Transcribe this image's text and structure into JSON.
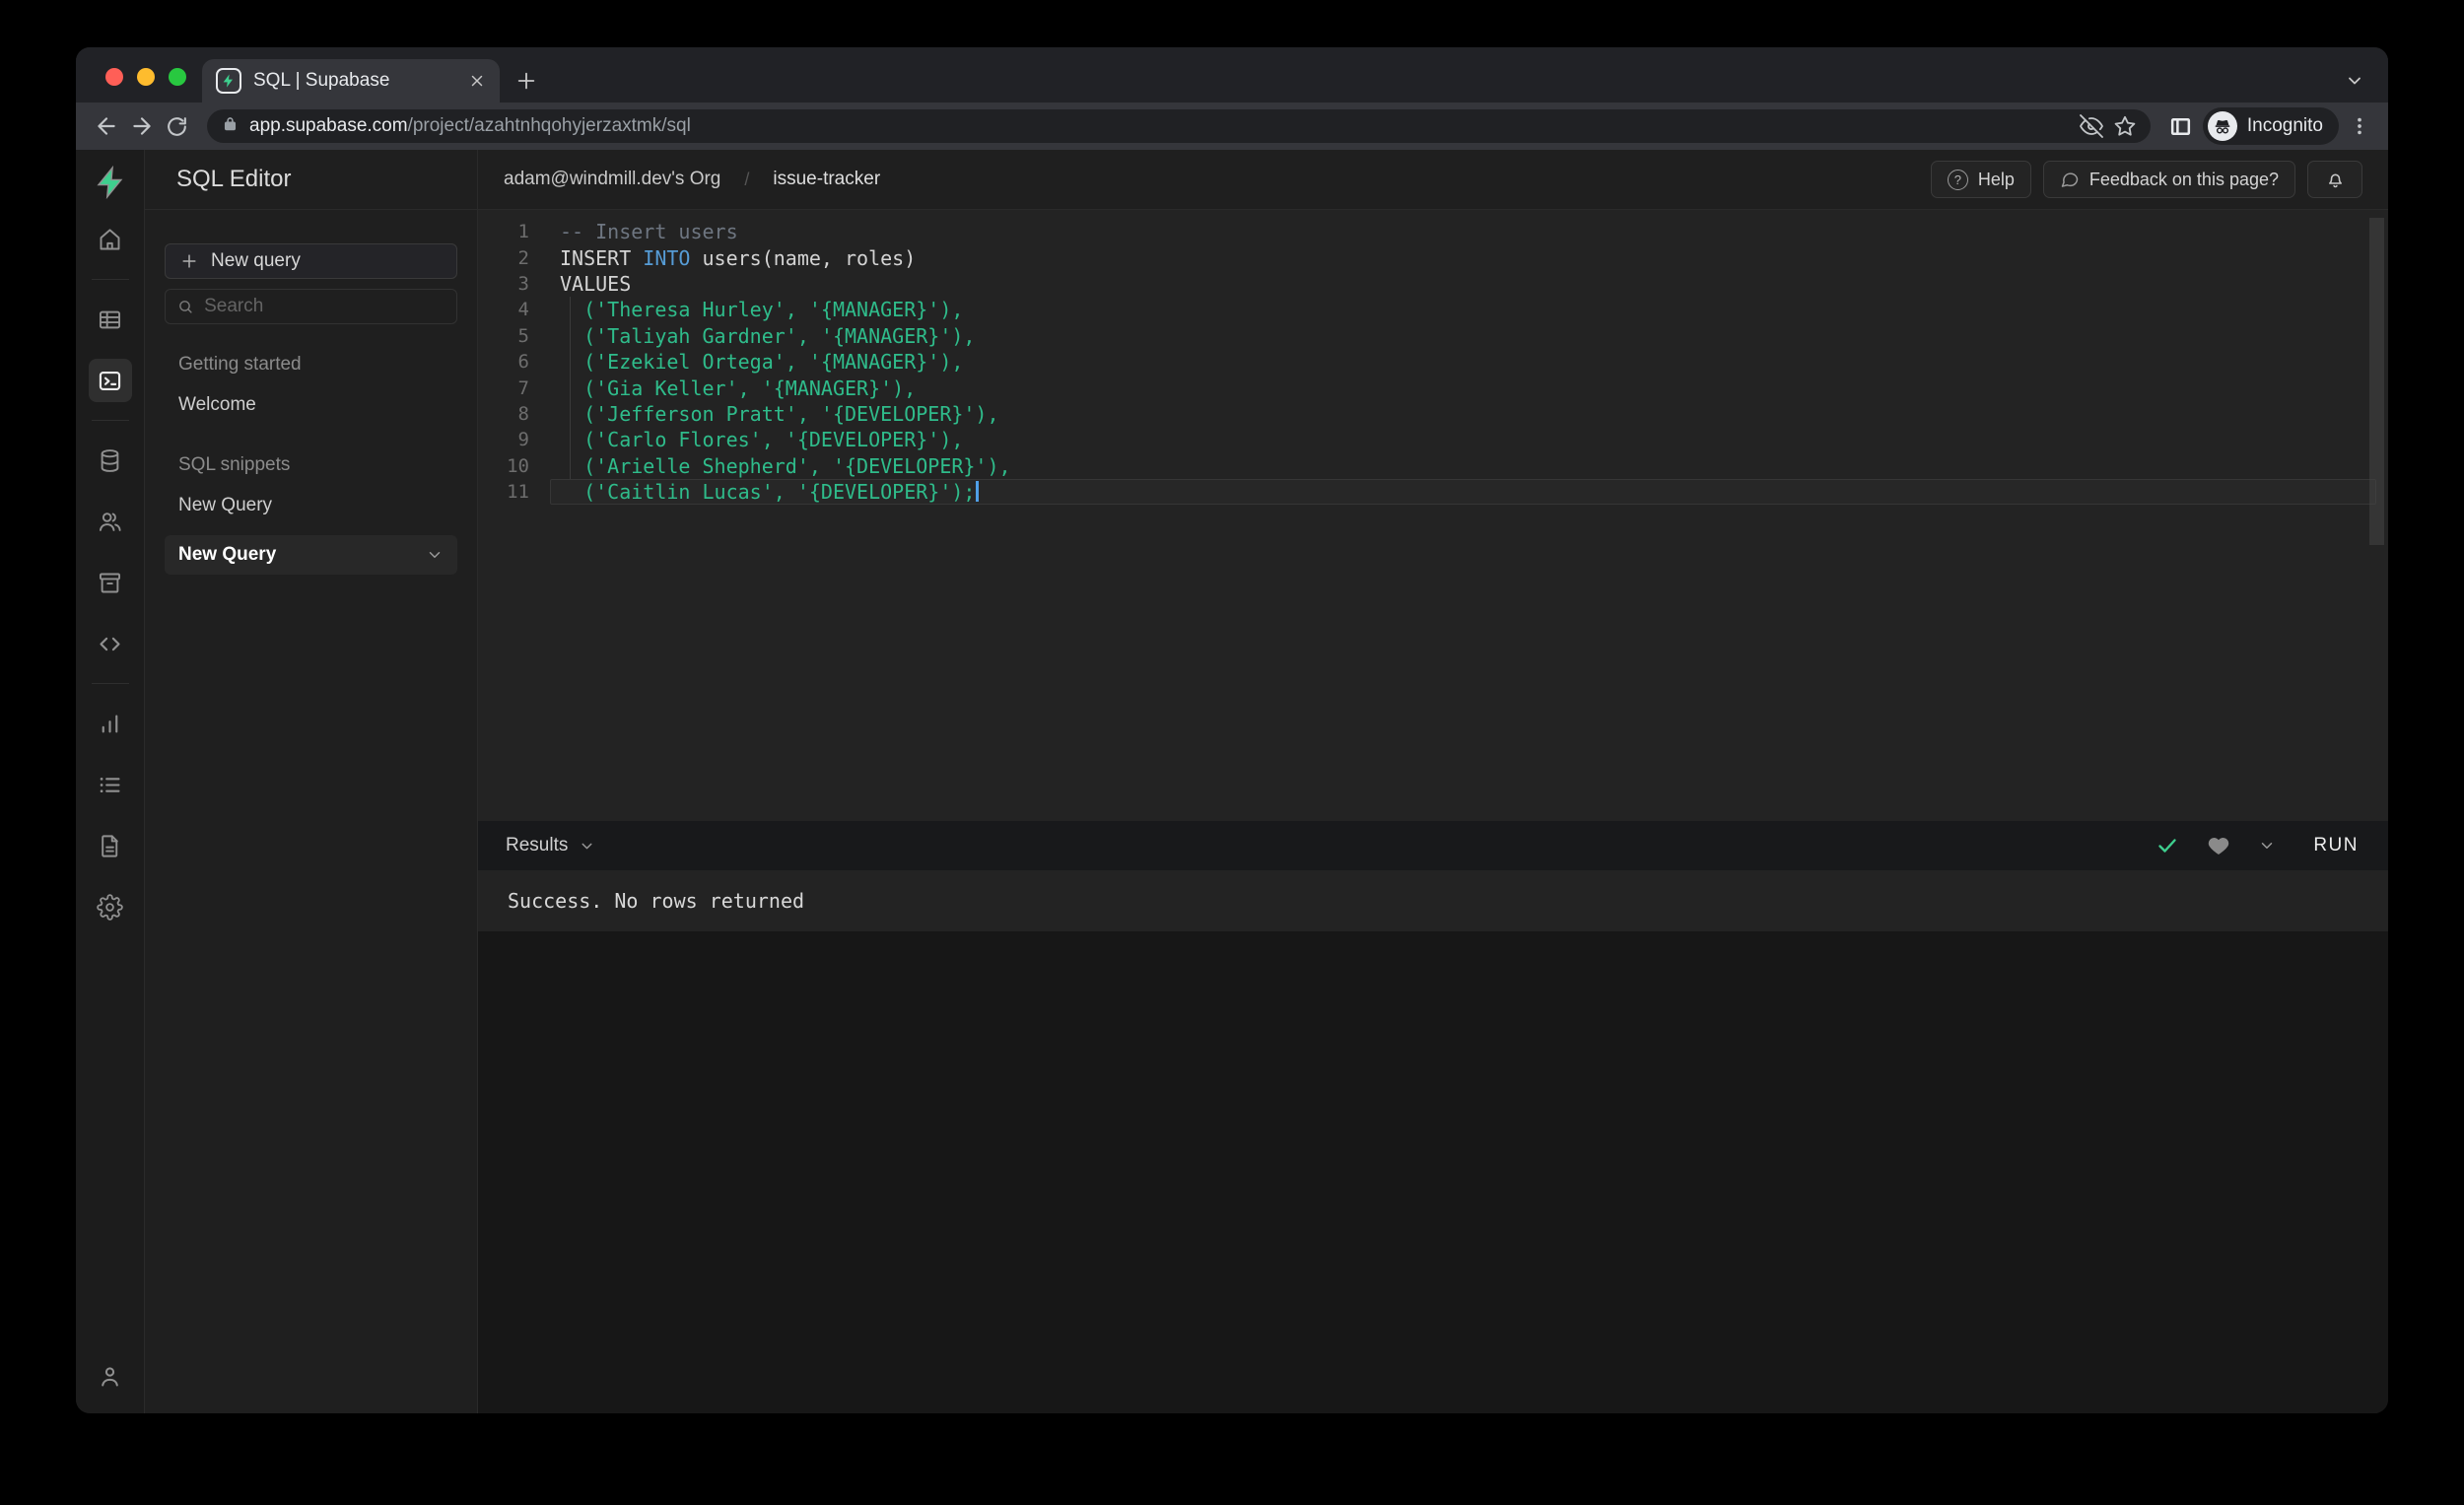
{
  "browser": {
    "tab_title": "SQL | Supabase",
    "url": {
      "domain": "app.supabase.com",
      "path": "/project/azahtnhqohyjerzaxtmk/sql"
    },
    "incognito_label": "Incognito"
  },
  "app": {
    "sidebar": {
      "title": "SQL Editor",
      "new_query_button": "New query",
      "search_placeholder": "Search",
      "sections": [
        {
          "label": "Getting started",
          "items": [
            {
              "label": "Welcome",
              "selected": false
            }
          ]
        },
        {
          "label": "SQL snippets",
          "items": [
            {
              "label": "New Query",
              "selected": false
            },
            {
              "label": "New Query",
              "selected": true
            }
          ]
        }
      ]
    },
    "header": {
      "breadcrumb": {
        "org": "adam@windmill.dev's Org",
        "separator": "/",
        "project": "issue-tracker"
      },
      "help_label": "Help",
      "help_icon_glyph": "?",
      "feedback_label": "Feedback on this page?"
    },
    "editor": {
      "lines": [
        {
          "n": 1,
          "segs": [
            [
              "comment",
              "-- Insert users"
            ]
          ]
        },
        {
          "n": 2,
          "segs": [
            [
              "plain",
              "INSERT "
            ],
            [
              "kw",
              "INTO"
            ],
            [
              "plain",
              " users(name, roles)"
            ]
          ]
        },
        {
          "n": 3,
          "segs": [
            [
              "plain",
              "VALUES"
            ]
          ]
        },
        {
          "n": 4,
          "segs": [
            [
              "str",
              "  ('Theresa Hurley', '{MANAGER}'),"
            ]
          ]
        },
        {
          "n": 5,
          "segs": [
            [
              "str",
              "  ('Taliyah Gardner', '{MANAGER}'),"
            ]
          ]
        },
        {
          "n": 6,
          "segs": [
            [
              "str",
              "  ('Ezekiel Ortega', '{MANAGER}'),"
            ]
          ]
        },
        {
          "n": 7,
          "segs": [
            [
              "str",
              "  ('Gia Keller', '{MANAGER}'),"
            ]
          ]
        },
        {
          "n": 8,
          "segs": [
            [
              "str",
              "  ('Jefferson Pratt', '{DEVELOPER}'),"
            ]
          ]
        },
        {
          "n": 9,
          "segs": [
            [
              "str",
              "  ('Carlo Flores', '{DEVELOPER}'),"
            ]
          ]
        },
        {
          "n": 10,
          "segs": [
            [
              "str",
              "  ('Arielle Shepherd', '{DEVELOPER}'),"
            ]
          ]
        },
        {
          "n": 11,
          "segs": [
            [
              "str",
              "  ('Caitlin Lucas', '{DEVELOPER}');"
            ]
          ],
          "active": true,
          "cursor": true
        }
      ]
    },
    "results": {
      "label": "Results",
      "run_label": "RUN",
      "status": "Success. No rows returned"
    }
  },
  "icons": {
    "rail": [
      "supabase-logo",
      "home-icon",
      "table-editor-icon",
      "sql-editor-terminal-icon",
      "database-icon",
      "auth-users-icon",
      "storage-archive-icon",
      "api-code-icon",
      "reports-chart-icon",
      "logs-list-icon",
      "docs-file-icon",
      "settings-gear-icon",
      "account-person-icon"
    ],
    "browser": [
      "back-arrow-icon",
      "forward-arrow-icon",
      "reload-icon",
      "lock-icon",
      "eye-off-icon",
      "star-icon",
      "side-panel-icon",
      "incognito-icon",
      "kebab-menu-icon",
      "close-icon",
      "new-tab-plus-icon",
      "chevron-down-icon"
    ],
    "results": [
      "success-check-icon",
      "favorite-heart-icon",
      "run-options-chevron-icon"
    ]
  },
  "colors": {
    "accent_green": "#3ecf8e",
    "keyword_blue": "#569cd6",
    "string_green": "#2fbc8b",
    "comment_gray": "#6e7681",
    "cursor_blue": "#4f9fe8"
  }
}
